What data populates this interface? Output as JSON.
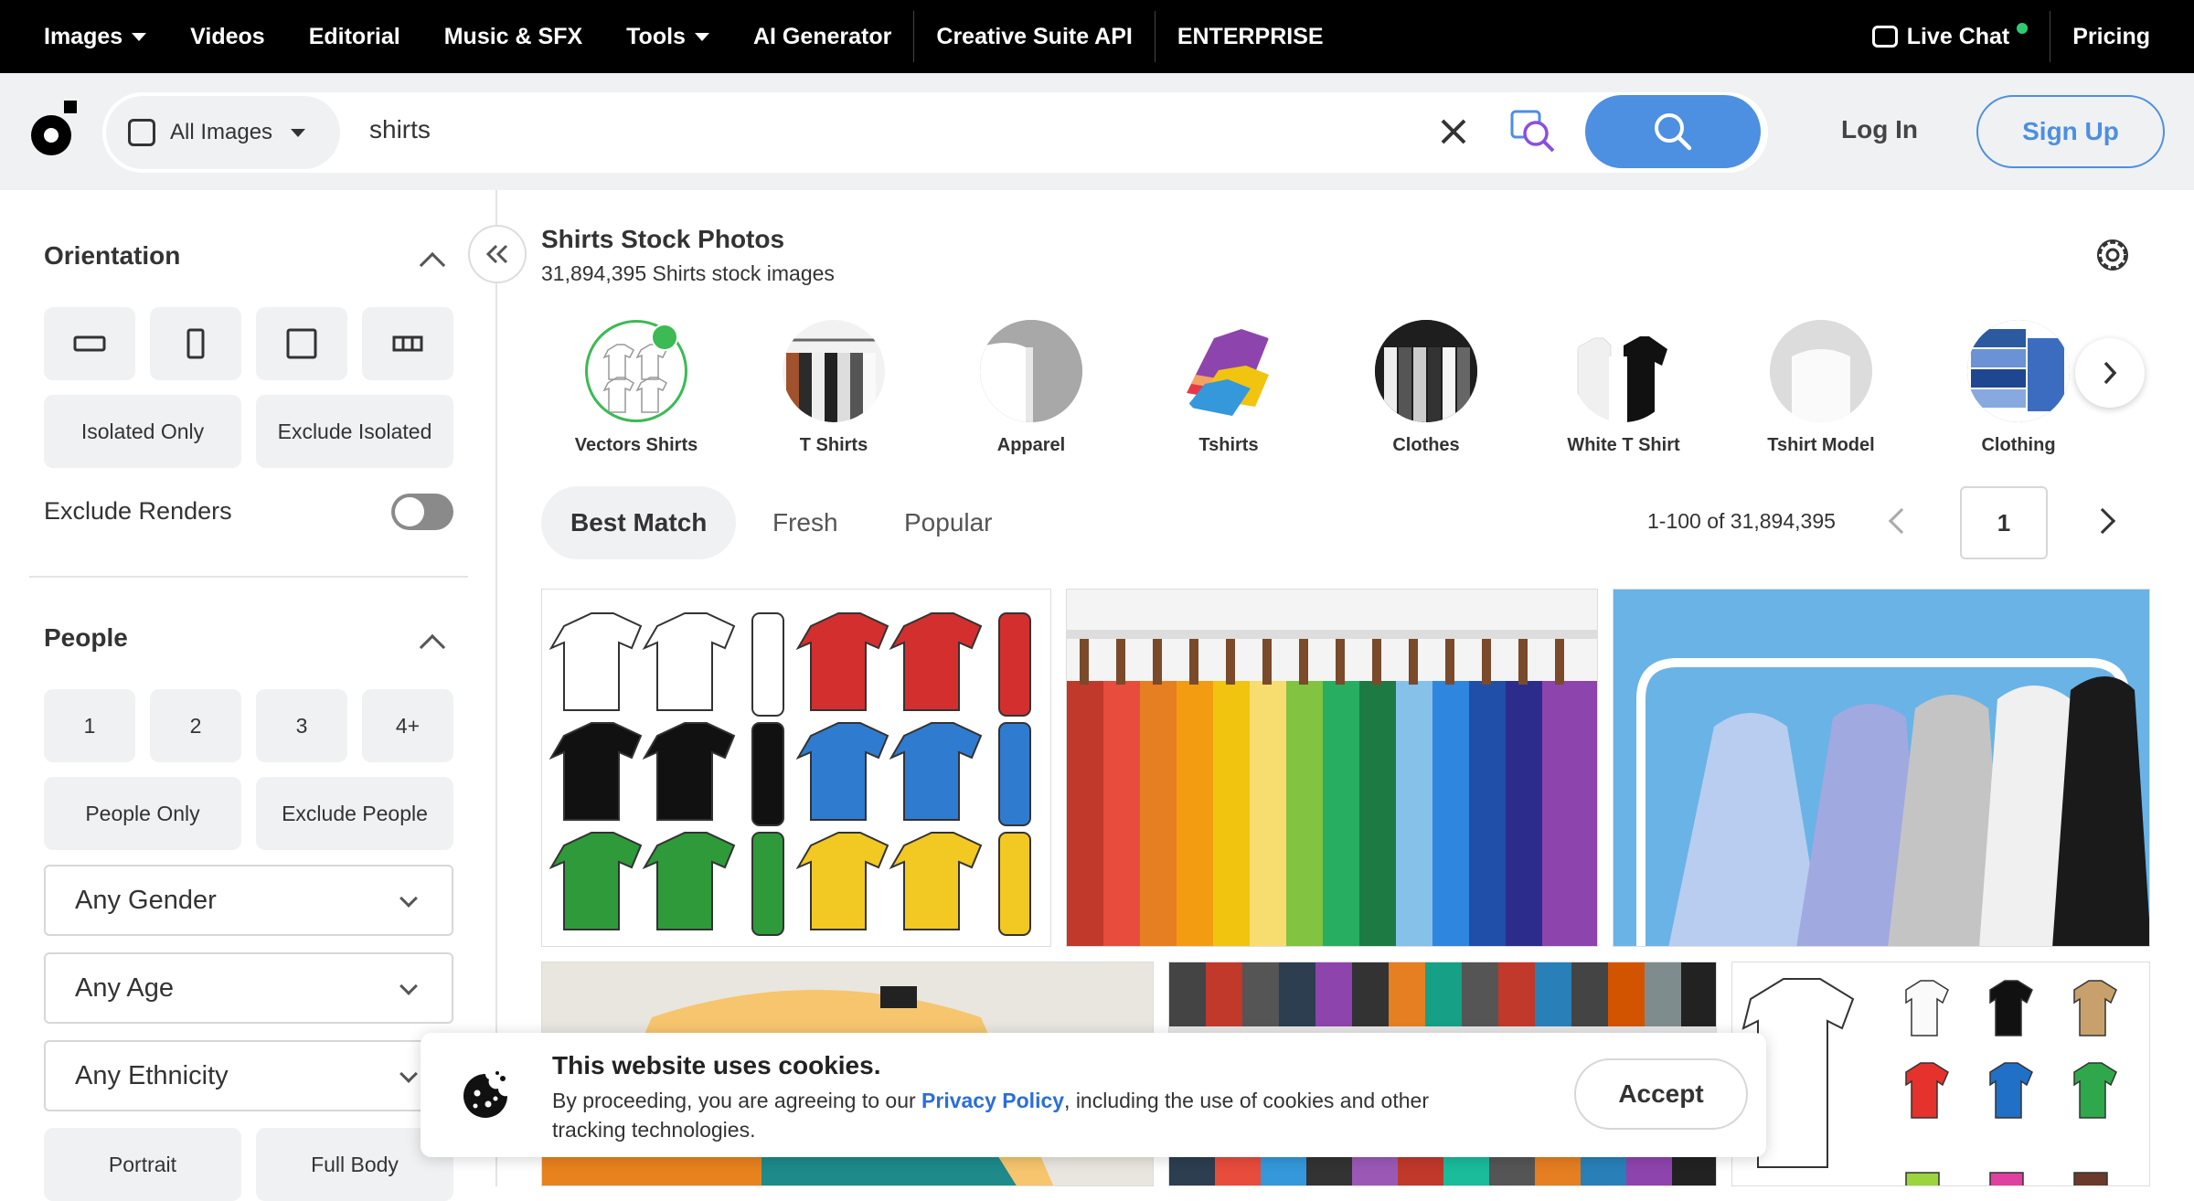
{
  "topnav": {
    "items": [
      "Images",
      "Videos",
      "Editorial",
      "Music & SFX",
      "Tools",
      "AI Generator",
      "Creative Suite API",
      "ENTERPRISE"
    ],
    "live_chat": "Live Chat",
    "pricing": "Pricing"
  },
  "search": {
    "scope": "All Images",
    "query": "shirts",
    "login": "Log In",
    "signup": "Sign Up"
  },
  "sidebar": {
    "orientation_title": "Orientation",
    "isolated_only": "Isolated Only",
    "exclude_isolated": "Exclude Isolated",
    "exclude_renders": "Exclude Renders",
    "people_title": "People",
    "people_counts": [
      "1",
      "2",
      "3",
      "4+"
    ],
    "people_only": "People Only",
    "exclude_people": "Exclude People",
    "gender": "Any Gender",
    "age": "Any Age",
    "ethnicity": "Any Ethnicity",
    "portrait": "Portrait",
    "full_body": "Full Body"
  },
  "main": {
    "title": "Shirts Stock Photos",
    "subtitle": "31,894,395 Shirts stock images",
    "categories": [
      "Vectors Shirts",
      "T Shirts",
      "Apparel",
      "Tshirts",
      "Clothes",
      "White T Shirt",
      "Tshirt Model",
      "Clothing"
    ],
    "sort_tabs": [
      "Best Match",
      "Fresh",
      "Popular"
    ],
    "range": "1-100 of 31,894,395",
    "page": "1"
  },
  "cookie": {
    "title": "This website uses cookies.",
    "text_before": "By proceeding, you are agreeing to our ",
    "link": "Privacy Policy",
    "text_after": ", including the use of cookies and other tracking technologies.",
    "accept": "Accept"
  },
  "colors": {
    "accent": "#4d8fe0",
    "nav_bg": "#000000",
    "green": "#2ecc71"
  }
}
